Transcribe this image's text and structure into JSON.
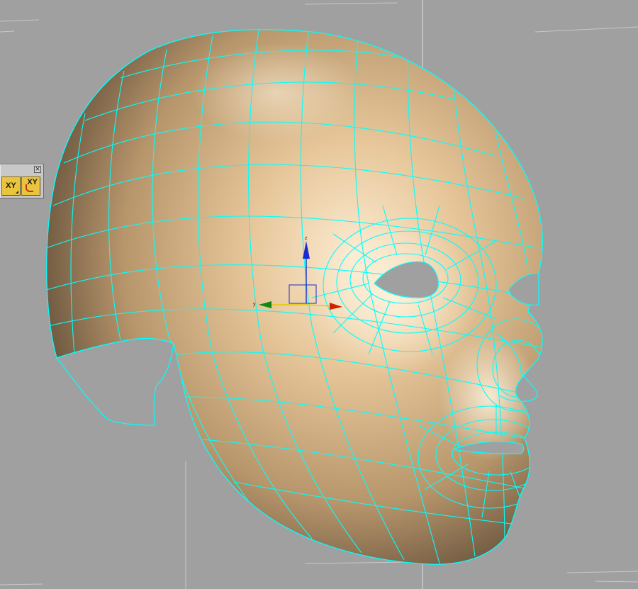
{
  "toolbar": {
    "close_glyph": "×",
    "buttons": [
      {
        "label": "XY",
        "icon": "axis-xy-constraint-icon"
      },
      {
        "label": "XY",
        "icon": "axis-xy-plane-icon"
      }
    ]
  },
  "gizmo": {
    "axis_z_label": "z",
    "axis_y_label": "y"
  },
  "colors": {
    "viewport_bg": "#a0a0a0",
    "wireframe": "#00ffff",
    "skin_light": "#f6dfbd",
    "skin_mid": "#d4b07f",
    "skin_dark": "#4a3a2a",
    "toolbar_button": "#e9c43c",
    "axis_x": "#cc2200",
    "axis_y": "#118811",
    "axis_z": "#1a2bd0",
    "axis_selected": "#e6c800"
  }
}
